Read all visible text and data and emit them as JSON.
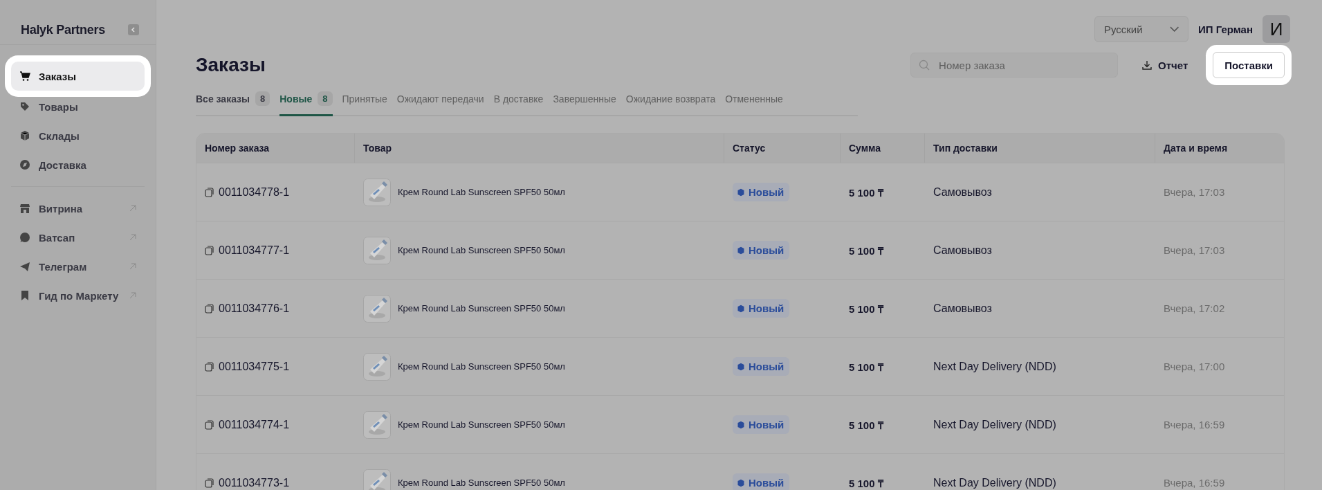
{
  "sidebar": {
    "logo": "Halyk Partners",
    "groups": [
      {
        "items": [
          {
            "label": "Заказы",
            "selected": true,
            "external": false
          },
          {
            "label": "Товары",
            "selected": false,
            "external": false
          },
          {
            "label": "Склады",
            "selected": false,
            "external": false
          },
          {
            "label": "Доставка",
            "selected": false,
            "external": false
          }
        ]
      },
      {
        "items": [
          {
            "label": "Витрина",
            "selected": false,
            "external": true
          },
          {
            "label": "Ватсап",
            "selected": false,
            "external": true
          },
          {
            "label": "Телеграм",
            "selected": false,
            "external": true
          },
          {
            "label": "Гид по Маркету",
            "selected": false,
            "external": true
          }
        ]
      }
    ]
  },
  "header": {
    "language": "Русский",
    "user": "ИП Герман",
    "avatar": "И"
  },
  "page": {
    "title": "Заказы",
    "search": {
      "placeholder": "Номер заказа"
    },
    "report_button": {
      "label": "Отчет",
      "spotlight": false
    },
    "supplies_button": {
      "label": "Поставки",
      "spotlight": true
    }
  },
  "tabs": [
    {
      "label": "Все заказы",
      "count": "8",
      "selected": false,
      "disabled": false
    },
    {
      "label": "Новые",
      "count": "8",
      "selected": true,
      "disabled": false
    },
    {
      "label": "Принятые",
      "selected": false,
      "disabled": true
    },
    {
      "label": "Ожидают передачи",
      "selected": false,
      "disabled": true
    },
    {
      "label": "В доставке",
      "selected": false,
      "disabled": true
    },
    {
      "label": "Завершенные",
      "selected": false,
      "disabled": true
    },
    {
      "label": "Ожидание возврата",
      "selected": false,
      "disabled": true
    },
    {
      "label": "Отмененные",
      "selected": false,
      "disabled": true
    }
  ],
  "table": {
    "columns": [
      "Номер заказа",
      "Товар",
      "Статус",
      "Сумма",
      "Тип доставки",
      "Дата и время"
    ],
    "rows": [
      {
        "order": "0011034778-1",
        "product": "Крем Round Lab Sunscreen SPF50 50мл",
        "status": "Новый",
        "sum": "5 100 ₸",
        "delivery": "Самовывоз",
        "date": "Вчера, 17:03"
      },
      {
        "order": "0011034777-1",
        "product": "Крем Round Lab Sunscreen SPF50 50мл",
        "status": "Новый",
        "sum": "5 100 ₸",
        "delivery": "Самовывоз",
        "date": "Вчера, 17:03"
      },
      {
        "order": "0011034776-1",
        "product": "Крем Round Lab Sunscreen SPF50 50мл",
        "status": "Новый",
        "sum": "5 100 ₸",
        "delivery": "Самовывоз",
        "date": "Вчера, 17:02"
      },
      {
        "order": "0011034775-1",
        "product": "Крем Round Lab Sunscreen SPF50 50мл",
        "status": "Новый",
        "sum": "5 100 ₸",
        "delivery": "Next Day Delivery (NDD)",
        "date": "Вчера, 17:00"
      },
      {
        "order": "0011034774-1",
        "product": "Крем Round Lab Sunscreen SPF50 50мл",
        "status": "Новый",
        "sum": "5 100 ₸",
        "delivery": "Next Day Delivery (NDD)",
        "date": "Вчера, 16:59"
      },
      {
        "order": "0011034773-1",
        "product": "Крем Round Lab Sunscreen SPF50 50мл",
        "status": "Новый",
        "sum": "5 100 ₸",
        "delivery": "Next Day Delivery (NDD)",
        "date": "Вчера, 16:59"
      }
    ]
  }
}
